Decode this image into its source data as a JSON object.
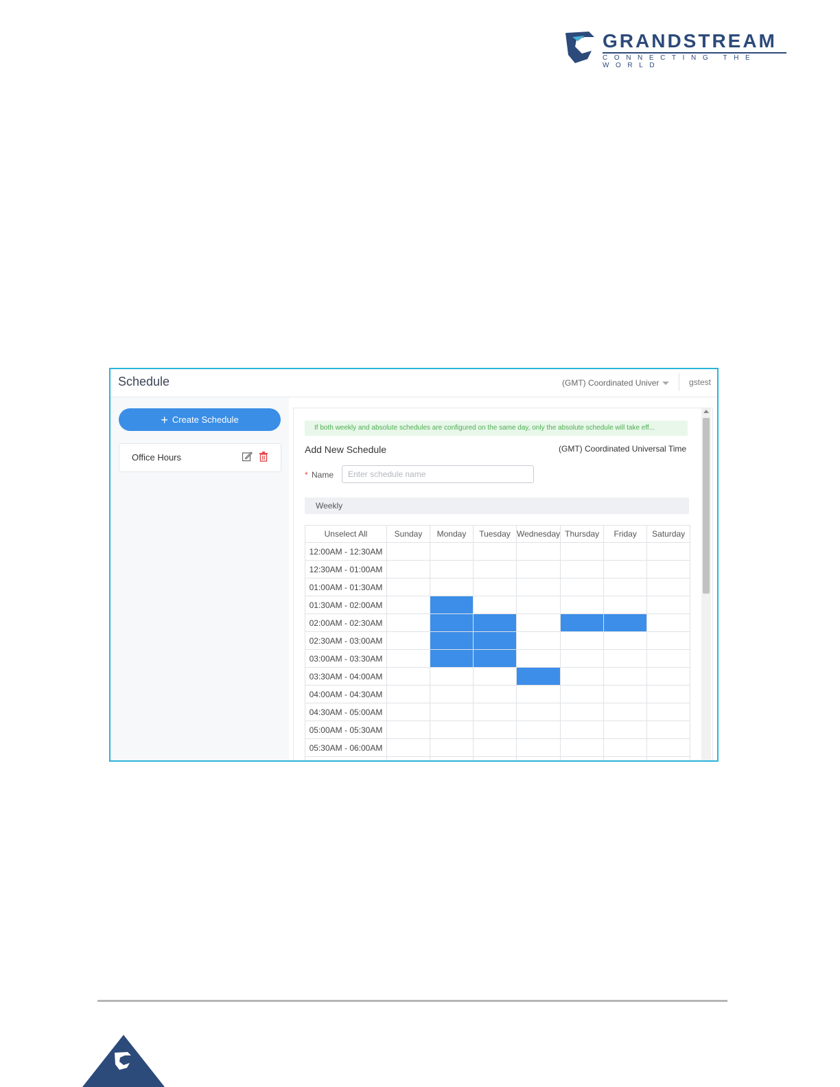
{
  "brand": {
    "name": "GRANDSTREAM",
    "tagline": "CONNECTING THE WORLD",
    "colors": {
      "primary": "#2c4a7a",
      "accent": "#3a8ee6",
      "frame": "#2bb3d9"
    }
  },
  "app": {
    "title": "Schedule",
    "timezone_select": "(GMT) Coordinated Univer",
    "user": "gstest"
  },
  "sidebar": {
    "create_button": "Create Schedule",
    "items": [
      {
        "label": "Office Hours",
        "icons": [
          "edit-icon",
          "delete-icon"
        ]
      }
    ]
  },
  "form": {
    "notice": "If both weekly and absolute schedules are configured on the same day, only the absolute schedule will take eff...",
    "title": "Add New Schedule",
    "timezone": "(GMT) Coordinated Universal Time",
    "required_mark": "*",
    "name_label": "Name",
    "name_placeholder": "Enter schedule name",
    "weekly_label": "Weekly"
  },
  "grid": {
    "unselect_all": "Unselect All",
    "days": [
      "Sunday",
      "Monday",
      "Tuesday",
      "Wednesday",
      "Thursday",
      "Friday",
      "Saturday"
    ],
    "rows": [
      {
        "time": "12:00AM - 12:30AM",
        "selected": [
          0,
          0,
          0,
          0,
          0,
          0,
          0
        ]
      },
      {
        "time": "12:30AM - 01:00AM",
        "selected": [
          0,
          0,
          0,
          0,
          0,
          0,
          0
        ]
      },
      {
        "time": "01:00AM - 01:30AM",
        "selected": [
          0,
          0,
          0,
          0,
          0,
          0,
          0
        ]
      },
      {
        "time": "01:30AM - 02:00AM",
        "selected": [
          0,
          1,
          0,
          0,
          0,
          0,
          0
        ]
      },
      {
        "time": "02:00AM - 02:30AM",
        "selected": [
          0,
          1,
          1,
          0,
          1,
          1,
          0
        ]
      },
      {
        "time": "02:30AM - 03:00AM",
        "selected": [
          0,
          1,
          1,
          0,
          0,
          0,
          0
        ]
      },
      {
        "time": "03:00AM - 03:30AM",
        "selected": [
          0,
          1,
          1,
          0,
          0,
          0,
          0
        ]
      },
      {
        "time": "03:30AM - 04:00AM",
        "selected": [
          0,
          0,
          0,
          1,
          0,
          0,
          0
        ]
      },
      {
        "time": "04:00AM - 04:30AM",
        "selected": [
          0,
          0,
          0,
          0,
          0,
          0,
          0
        ]
      },
      {
        "time": "04:30AM - 05:00AM",
        "selected": [
          0,
          0,
          0,
          0,
          0,
          0,
          0
        ]
      },
      {
        "time": "05:00AM - 05:30AM",
        "selected": [
          0,
          0,
          0,
          0,
          0,
          0,
          0
        ]
      },
      {
        "time": "05:30AM - 06:00AM",
        "selected": [
          0,
          0,
          0,
          0,
          0,
          0,
          0
        ]
      },
      {
        "time": "",
        "selected": [
          0,
          0,
          0,
          0,
          0,
          0,
          0
        ]
      }
    ]
  }
}
